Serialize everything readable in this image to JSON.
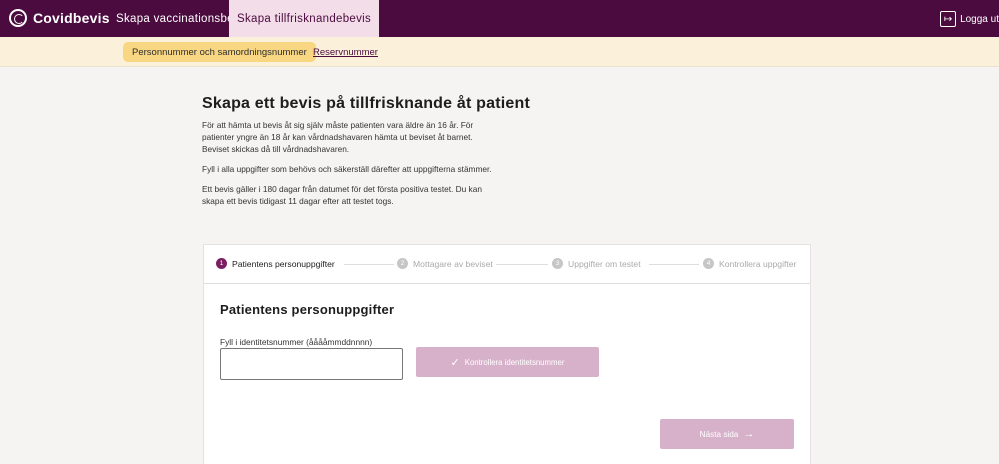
{
  "header": {
    "app_name": "Covidbevis",
    "tabs": [
      {
        "label": "Skapa vaccinationsbevis"
      },
      {
        "label": "Skapa tillfrisknandebevis"
      }
    ],
    "logout_label": "Logga ut"
  },
  "subnav": {
    "items": [
      {
        "label": "Personnummer och samordningsnummer"
      },
      {
        "label": "Reservnummer"
      }
    ]
  },
  "intro": {
    "title": "Skapa ett bevis på tillfrisknande åt patient",
    "paragraphs": [
      "För att hämta ut bevis åt sig själv måste patienten vara äldre än 16 år. För patienter yngre än 18 år kan vårdnadshavaren hämta ut beviset åt barnet. Beviset skickas då till vårdnadshavaren.",
      "Fyll i alla uppgifter som behövs och säkerställ därefter att uppgifterna stämmer.",
      "Ett bevis gäller i 180 dagar från datumet för det första positiva testet. Du kan skapa ett bevis tidigast 11 dagar efter att testet togs."
    ]
  },
  "stepper": {
    "steps": [
      {
        "number": "1",
        "label": "Patientens personuppgifter"
      },
      {
        "number": "2",
        "label": "Mottagare av beviset"
      },
      {
        "number": "3",
        "label": "Uppgifter om testet"
      },
      {
        "number": "4",
        "label": "Kontrollera uppgifter"
      }
    ]
  },
  "form": {
    "section_title": "Patientens personuppgifter",
    "id_label": "Fyll i identitetsnummer (ååååmmddnnnn)",
    "id_value": "",
    "check_button_label": "Kontrollera identitetsnummer",
    "next_button_label": "Nästa sida"
  },
  "colors": {
    "header_bg": "#4b0b3f",
    "active_tab_bg": "#f2dde9",
    "subbar_bg": "#fbf0da",
    "subtab_active_bg": "#f9d681",
    "disabled_button_bg": "#d7b1ca",
    "step_active": "#7b1f63"
  },
  "icons": {
    "logo": "covidbevis-logo-icon",
    "logout": "logout-icon",
    "check": "check-icon",
    "arrow": "arrow-right-icon"
  }
}
